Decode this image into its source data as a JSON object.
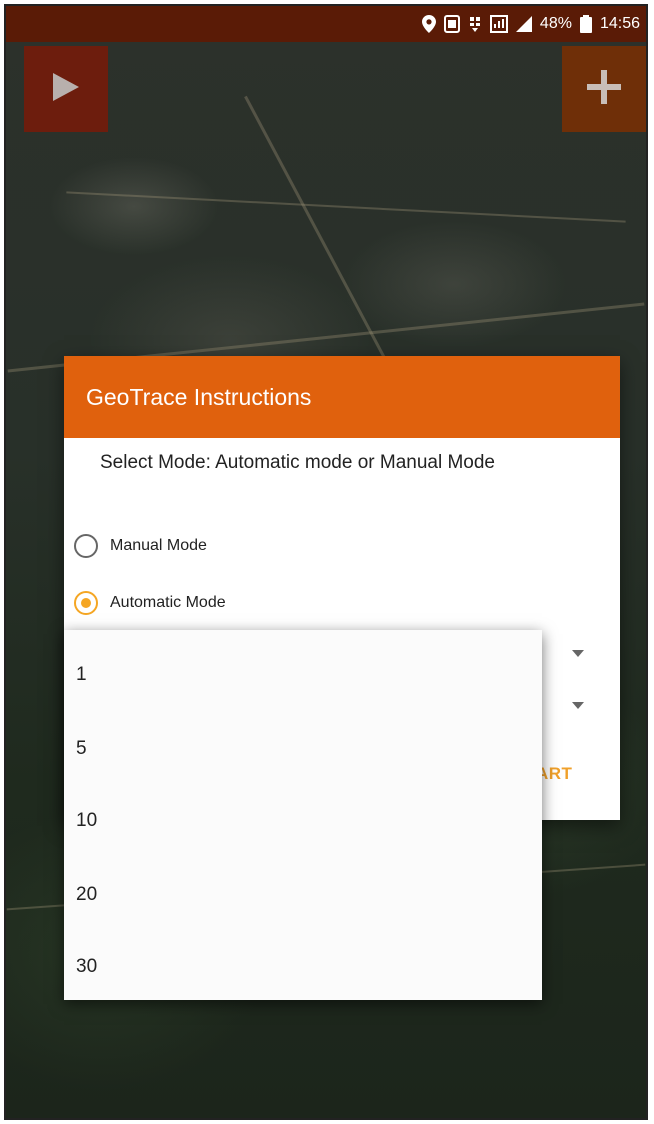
{
  "status_bar": {
    "battery": "48%",
    "time": "14:56",
    "icons": [
      "location-icon",
      "nfc-icon",
      "data-4g-icon",
      "signal-icon",
      "battery-icon"
    ]
  },
  "toolbar": {
    "play_icon": "play-icon",
    "add_icon": "plus-icon"
  },
  "dialog": {
    "title": "GeoTrace Instructions",
    "subtitle": "Select Mode: Automatic mode or Manual Mode",
    "options": [
      {
        "label": "Manual Mode",
        "selected": false
      },
      {
        "label": "Automatic Mode",
        "selected": true
      }
    ],
    "start_label_visible": "ART"
  },
  "dropdown": {
    "options": [
      "1",
      "5",
      "10",
      "20",
      "30"
    ]
  },
  "colors": {
    "header": "#e0610d",
    "status_bar": "#5a1b06",
    "accent": "#f5a623"
  }
}
